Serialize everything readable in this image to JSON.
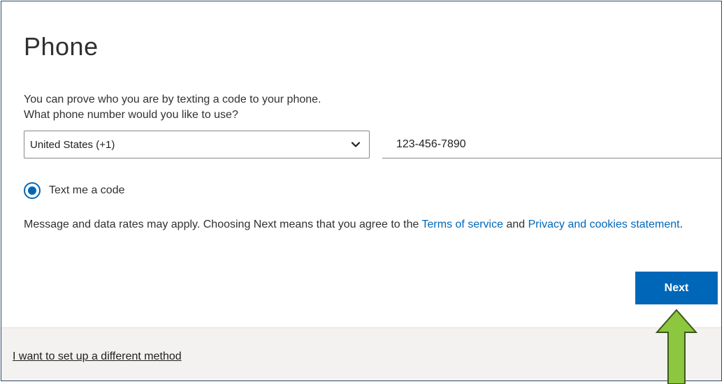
{
  "heading": "Phone",
  "description_line1": "You can prove who you are by texting a code to your phone.",
  "description_line2": "What phone number would you like to use?",
  "country_select": {
    "value": "United States (+1)"
  },
  "phone_input": {
    "value": "123-456-7890"
  },
  "method_option": {
    "label": "Text me a code",
    "selected": true
  },
  "notice": {
    "text_before": "Message and data rates may apply. Choosing Next means that you agree to the ",
    "terms_link": "Terms of service",
    "text_middle": " and ",
    "privacy_link": "Privacy and cookies statement",
    "text_after": "."
  },
  "next_button": {
    "label": "Next"
  },
  "footer": {
    "different_method_link": "I want to set up a different method"
  },
  "colors": {
    "accent": "#0067b8",
    "annotation_arrow": "#8dc63f",
    "footer_bg": "#f3f2f1"
  },
  "icons": {
    "dropdown": "chevron-down-icon",
    "annotation": "up-arrow-annotation"
  }
}
